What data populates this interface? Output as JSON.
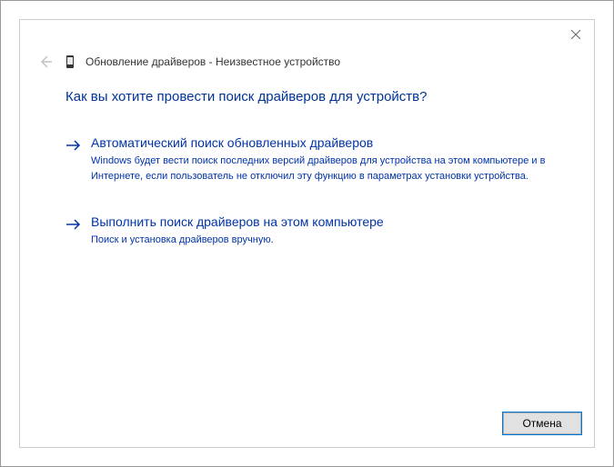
{
  "header": {
    "title": "Обновление драйверов - Неизвестное устройство"
  },
  "heading": "Как вы хотите провести поиск драйверов для устройств?",
  "options": [
    {
      "title": "Автоматический поиск обновленных драйверов",
      "desc": "Windows будет вести поиск последних версий драйверов для устройства на этом компьютере и в Интернете, если пользователь не отключил эту функцию в параметрах установки устройства."
    },
    {
      "title": "Выполнить поиск драйверов на этом компьютере",
      "desc": "Поиск и установка драйверов вручную."
    }
  ],
  "footer": {
    "cancel": "Отмена"
  }
}
